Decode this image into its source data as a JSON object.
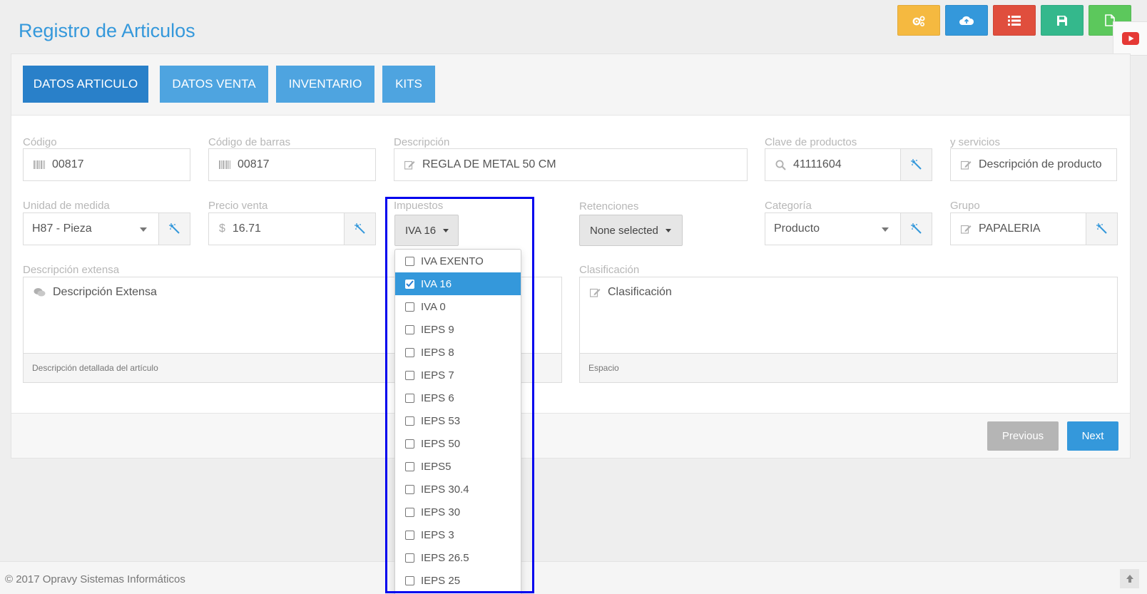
{
  "page": {
    "title": "Registro de Articulos"
  },
  "colors": {
    "primary": "#3498db",
    "tab_active": "#2980c9",
    "tab": "#4ea4e0",
    "yellow": "#f5b940",
    "blue": "#3498db",
    "red": "#e04e3d",
    "teal": "#34b88c",
    "green": "#5cc85c",
    "youtube": "#e53935",
    "prev": "#b5b5b5",
    "next": "#3498db",
    "highlight": "#0000ee"
  },
  "top_actions": [
    {
      "name": "settings-button",
      "icon": "gears-icon",
      "color": "#f5b940"
    },
    {
      "name": "cloud-upload-button",
      "icon": "cloud-upload-icon",
      "color": "#3498db"
    },
    {
      "name": "list-button",
      "icon": "list-icon",
      "color": "#e04e3d"
    },
    {
      "name": "save-button",
      "icon": "save-icon",
      "color": "#34b88c"
    },
    {
      "name": "new-document-button",
      "icon": "file-icon",
      "color": "#5cc85c"
    }
  ],
  "youtube": {
    "icon": "youtube-icon"
  },
  "tabs": [
    {
      "label": "DATOS ARTICULO",
      "active": true
    },
    {
      "label": "DATOS VENTA",
      "active": false
    },
    {
      "label": "INVENTARIO",
      "active": false
    },
    {
      "label": "KITS",
      "active": false
    }
  ],
  "form": {
    "codigo": {
      "label": "Código",
      "value": "00817"
    },
    "codigo_barras": {
      "label": "Código de barras",
      "value": "00817"
    },
    "descripcion": {
      "label": "Descripción",
      "value": "REGLA DE METAL 50 CM"
    },
    "clave_productos": {
      "label": "Clave de productos",
      "value": "41111604"
    },
    "servicios": {
      "label": "y servicios",
      "placeholder": "Descripción de producto"
    },
    "unidad": {
      "label": "Unidad de medida",
      "value": "H87 - Pieza"
    },
    "precio": {
      "label": "Precio venta",
      "currency": "$",
      "value": "16.71"
    },
    "impuestos": {
      "label": "Impuestos",
      "value": "IVA 16"
    },
    "retenciones": {
      "label": "Retenciones",
      "value": "None selected"
    },
    "categoria": {
      "label": "Categoría",
      "value": "Producto"
    },
    "grupo": {
      "label": "Grupo",
      "value": "PAPALERIA"
    },
    "desc_extensa": {
      "label": "Descripción extensa",
      "placeholder": "Descripción Extensa",
      "help": "Descripción detallada del artículo"
    },
    "clasificacion": {
      "label": "Clasificación",
      "placeholder": "Clasificación",
      "help": "Espacio"
    }
  },
  "impuestos_options": [
    {
      "label": "IVA EXENTO",
      "checked": false
    },
    {
      "label": "IVA 16",
      "checked": true
    },
    {
      "label": "IVA 0",
      "checked": false
    },
    {
      "label": "IEPS 9",
      "checked": false
    },
    {
      "label": "IEPS 8",
      "checked": false
    },
    {
      "label": "IEPS 7",
      "checked": false
    },
    {
      "label": "IEPS 6",
      "checked": false
    },
    {
      "label": "IEPS 53",
      "checked": false
    },
    {
      "label": "IEPS 50",
      "checked": false
    },
    {
      "label": "IEPS5",
      "checked": false
    },
    {
      "label": "IEPS 30.4",
      "checked": false
    },
    {
      "label": "IEPS 30",
      "checked": false
    },
    {
      "label": "IEPS 3",
      "checked": false
    },
    {
      "label": "IEPS 26.5",
      "checked": false
    },
    {
      "label": "IEPS 25",
      "checked": false
    }
  ],
  "pager": {
    "previous": "Previous",
    "next": "Next"
  },
  "footer": {
    "copyright": "© 2017 Opravy Sistemas Informáticos"
  }
}
